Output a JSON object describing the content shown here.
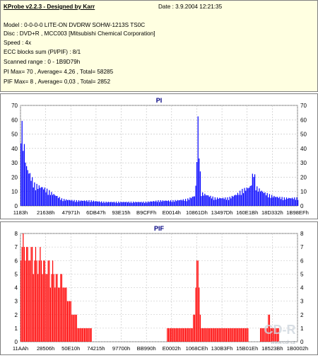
{
  "header": {
    "app_title": "KProbe v2.2.3 - Designed by Karr",
    "date": "Date : 3.9.2004 12:21:35",
    "model": "Model : 0-0-0-0 LITE-ON DVDRW SOHW-1213S TS0C",
    "disc": "Disc : DVD+R , MCC003 [Mitsubishi Chemical Corporation]",
    "speed": "Speed : 4x",
    "ecc": "ECC blocks sum (PI/PIF) : 8/1",
    "range": "Scanned range : 0 - 1B9D79h",
    "pi_stats": "PI Max= 70 , Average= 4,26 , Total= 58285",
    "pif_stats": "PIF Max= 8 , Average= 0,03 , Total= 2852"
  },
  "watermark": {
    "text": "CD-R",
    "sub": "www.cdr.cz"
  },
  "colors": {
    "pi_bar": "#0000ff",
    "pif_bar": "#ff0000",
    "chart_title": "#000080",
    "grid": "#c0c0c0",
    "header_bg": "#ffffe1"
  },
  "chart_data": [
    {
      "type": "bar",
      "title": "PI",
      "ylim": [
        0,
        70
      ],
      "y_ticks": [
        0,
        10,
        20,
        30,
        40,
        50,
        60,
        70
      ],
      "x_tick_labels": [
        "1183h",
        "21638h",
        "47971h",
        "6DB47h",
        "93E15h",
        "B9CFFh",
        "E0014h",
        "10861Dh",
        "13497Dh",
        "160E1Bh",
        "18D332h",
        "1B98EFh"
      ],
      "x": [
        0.0,
        0.02,
        0.05,
        0.08,
        0.11,
        0.15,
        0.2,
        0.25,
        0.3,
        0.35,
        0.4,
        0.45,
        0.5,
        0.55,
        0.6,
        0.63,
        0.64,
        0.65,
        0.7,
        0.75,
        0.78,
        0.8,
        0.83,
        0.84,
        0.85,
        0.88,
        0.9,
        0.92,
        0.95,
        0.98,
        1.0
      ],
      "values": [
        67,
        30,
        16,
        14,
        10,
        5,
        4,
        4,
        3,
        3,
        3,
        3,
        4,
        4,
        5,
        8,
        67,
        10,
        6,
        6,
        9,
        12,
        15,
        28,
        14,
        10,
        8,
        7,
        6,
        6,
        6
      ],
      "grid": true,
      "series": [
        {
          "values_color": "#0000ff"
        }
      ]
    },
    {
      "type": "bar",
      "title": "PIF",
      "ylim": [
        0,
        8
      ],
      "y_ticks": [
        0,
        1,
        2,
        3,
        4,
        5,
        6,
        7,
        8
      ],
      "x_tick_labels": [
        "11AAh",
        "28506h",
        "50E10h",
        "74215h",
        "97700h",
        "BB990h",
        "E0002h",
        "1068CEh",
        "130B3Fh",
        "15B01Eh",
        "18523Bh",
        "1B0002h"
      ],
      "x": [
        0.0,
        0.05,
        0.1,
        0.15,
        0.18,
        0.2,
        0.21,
        0.22,
        0.3,
        0.4,
        0.5,
        0.55,
        0.6,
        0.62,
        0.64,
        0.65,
        0.7,
        0.8,
        0.85,
        0.9,
        0.91,
        0.92,
        0.95,
        1.0
      ],
      "values": [
        8,
        7,
        6,
        5,
        3,
        2,
        1,
        1,
        0,
        0,
        0,
        1,
        1,
        1,
        7,
        1,
        1,
        1,
        0,
        2,
        1,
        1,
        0,
        0
      ],
      "grid": true
    }
  ]
}
